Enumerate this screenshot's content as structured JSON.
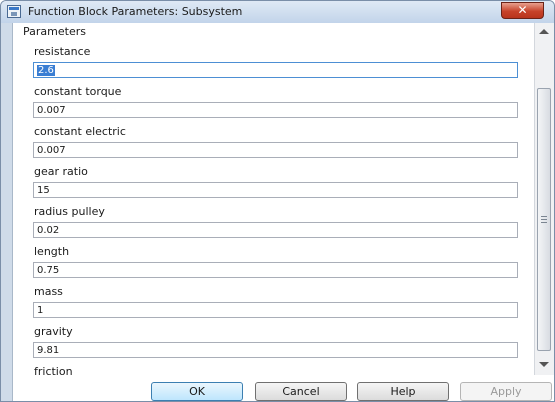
{
  "window": {
    "title": "Function Block Parameters: Subsystem"
  },
  "group": {
    "label": "Parameters"
  },
  "fields": [
    {
      "label": "resistance",
      "value": "2.6"
    },
    {
      "label": "constant torque",
      "value": "0.007"
    },
    {
      "label": "constant electric",
      "value": "0.007"
    },
    {
      "label": "gear ratio",
      "value": "15"
    },
    {
      "label": "radius pulley",
      "value": "0.02"
    },
    {
      "label": "length",
      "value": "0.75"
    },
    {
      "label": "mass",
      "value": "1"
    },
    {
      "label": "gravity",
      "value": "9.81"
    },
    {
      "label": "friction"
    }
  ],
  "buttons": {
    "ok": "OK",
    "cancel": "Cancel",
    "help": "Help",
    "apply": "Apply"
  },
  "icons": {
    "app": "simulink-block-icon",
    "close": "close-icon",
    "scroll_up": "chevron-up-icon",
    "scroll_down": "chevron-down-icon"
  },
  "colors": {
    "titlebar": "#c2d4ea",
    "close_button": "#c7432b",
    "selection": "#3a7ed3"
  }
}
